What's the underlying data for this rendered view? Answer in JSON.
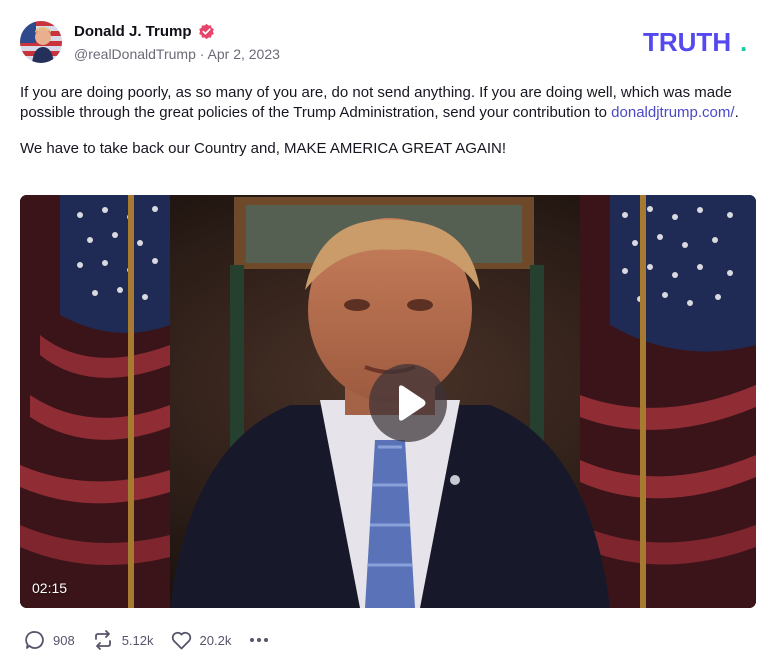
{
  "post": {
    "author_name": "Donald J. Trump",
    "handle": "@realDonaldTrump",
    "separator": " · ",
    "date": "Apr 2, 2023",
    "text_para1_prefix": "If you are doing poorly, as so many of you are, do not send anything. If you are doing well, which was made possible through the great policies of the Trump Administration, send your contribution to ",
    "link_text": "donaldjtrump.com/",
    "text_para1_suffix": ".",
    "text_para2": "We have to take back our Country and, MAKE AMERICA GREAT AGAIN!"
  },
  "brand": {
    "logo_text": "TRUTH",
    "logo_dot": ".",
    "logo_color": "#5448ee",
    "dot_color": "#17c9a8"
  },
  "video": {
    "duration": "02:15"
  },
  "actions": {
    "replies": "908",
    "retruths": "5.12k",
    "likes": "20.2k"
  },
  "icons": {
    "verified": "verified-badge-icon",
    "reply": "comment-icon",
    "retruth": "repost-icon",
    "like": "heart-icon",
    "more": "more-dots-icon",
    "play": "play-icon"
  }
}
